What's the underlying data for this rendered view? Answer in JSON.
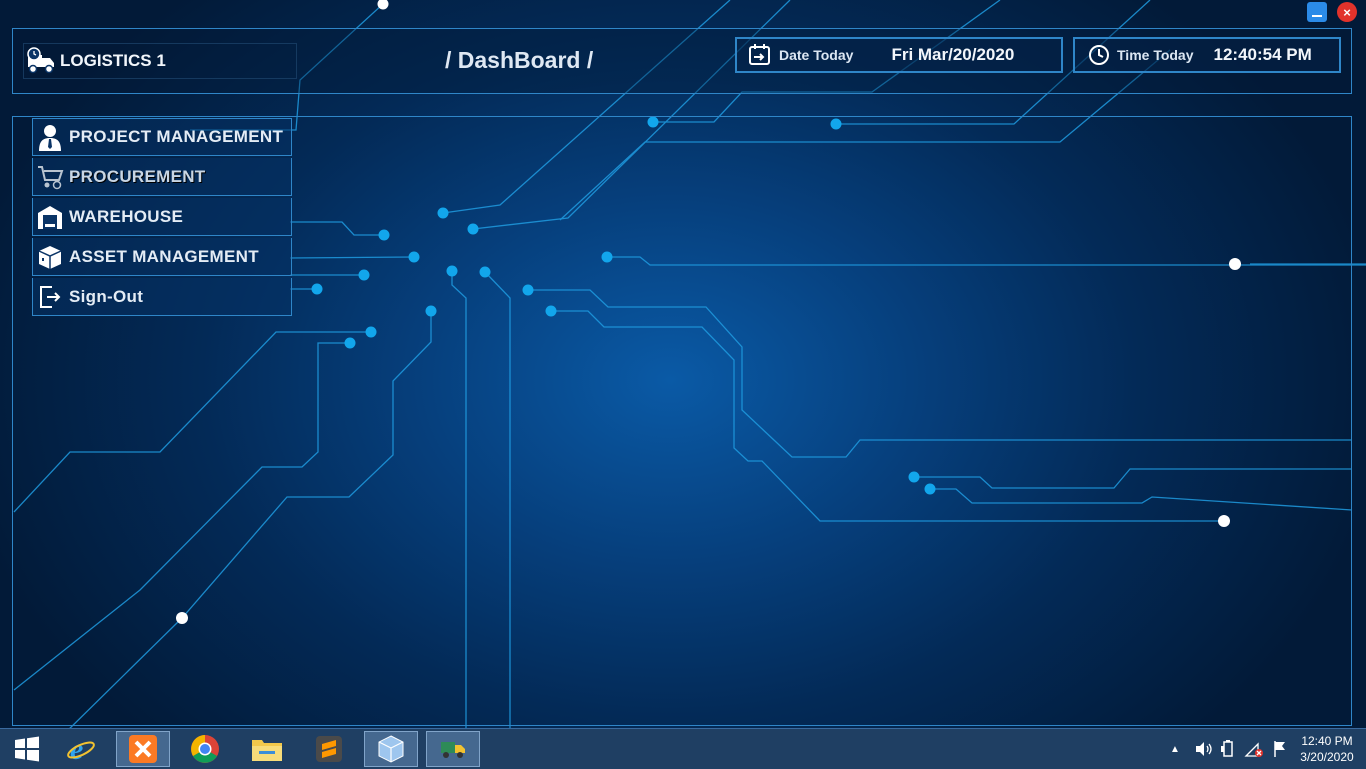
{
  "window": {
    "minimize_icon": "minimize-icon",
    "close_label": "×"
  },
  "header": {
    "app_name": "LOGISTICS 1",
    "logo_icon": "delivery-truck-clock-icon",
    "page_title": "/ DashBoard /",
    "date_label": "Date Today",
    "date_value": "Fri Mar/20/2020",
    "date_icon": "calendar-arrow-icon",
    "time_label": "Time Today",
    "time_value": "12:40:54 PM",
    "time_icon": "clock-icon"
  },
  "menu": {
    "items": [
      {
        "label": "PROJECT MANAGEMENT",
        "icon": "businessman-icon"
      },
      {
        "label": "PROCUREMENT",
        "icon": "shopping-cart-icon"
      },
      {
        "label": "WAREHOUSE",
        "icon": "warehouse-icon"
      },
      {
        "label": "ASSET MANAGEMENT",
        "icon": "package-box-icon"
      },
      {
        "label": "Sign-Out",
        "icon": "sign-out-icon"
      }
    ]
  },
  "taskbar": {
    "apps": [
      "windows-start-icon",
      "internet-explorer-icon",
      "xampp-icon",
      "chrome-icon",
      "file-explorer-icon",
      "sublime-text-icon",
      "virtualbox-icon",
      "logistics-app-icon"
    ],
    "tray_icons": [
      "show-hidden-icon",
      "volume-icon",
      "power-icon",
      "network-error-icon",
      "action-center-flag-icon"
    ],
    "clock_time": "12:40 PM",
    "clock_date": "3/20/2020"
  },
  "colors": {
    "accent": "#2f86c8",
    "circuit_line": "#1f9be0",
    "node": "#12a6ec",
    "close": "#e2322b",
    "minimize": "#2b8be8"
  }
}
